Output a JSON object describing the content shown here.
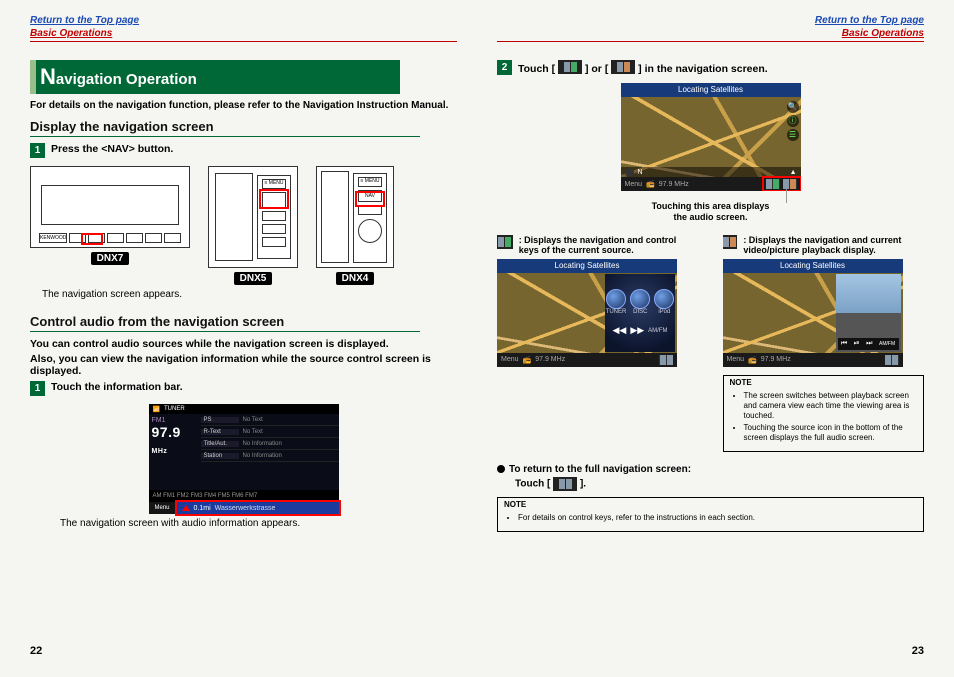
{
  "nav": {
    "return_top": "Return to the Top page",
    "basic_ops": "Basic Operations"
  },
  "section_title": {
    "big": "N",
    "rest": "avigation Operation"
  },
  "detail_note": "For details on the navigation function, please refer to the Navigation Instruction Manual.",
  "h2_display": "Display the navigation screen",
  "step1a": {
    "num": "1",
    "text": "Press the <NAV> button."
  },
  "devices": {
    "dnx7": "DNX7",
    "dnx5": "DNX5",
    "dnx4": "DNX4",
    "kenwood": "KENWOOD",
    "menu": "≡ MENU",
    "nav_label": "NAV"
  },
  "caption_nav_appears": "The navigation screen appears.",
  "h2_control": "Control audio from the navigation screen",
  "control_p1": "You can control audio sources while the navigation screen is displayed.",
  "control_p2": "Also, you can view the navigation information while the source control screen is displayed.",
  "step1b": {
    "num": "1",
    "text": "Touch the information bar."
  },
  "tuner": {
    "top": "TUNER",
    "band": "FM1",
    "freq": "97.9",
    "mhz": "MHz",
    "rows": [
      {
        "lab": "PS",
        "val": "No Text"
      },
      {
        "lab": "R-Text",
        "val": "No Text"
      },
      {
        "lab": "Title/Aut.",
        "val": "No Information"
      },
      {
        "lab": "Station",
        "val": "No Information"
      }
    ],
    "bottom_bands": "AM   FM1   FM2   FM3   FM4   FM5   FM6   FM7",
    "menu": "Menu",
    "info_dist": "0.1mi",
    "info_street": "Wasserwerkstrasse"
  },
  "caption_nav_audio": "The navigation screen with audio information appears.",
  "right": {
    "step2": {
      "num": "2",
      "text_a": "Touch [",
      "text_b": "] or [",
      "text_c": "] in the navigation screen."
    },
    "sat": "Locating Satellites",
    "map_menu": "Menu",
    "map_n": "N",
    "map_freq": "97.9 MHz",
    "touch_area_caption1": "Touching this area displays",
    "touch_area_caption2": "the audio screen.",
    "icon_def1": ": Displays the navigation and control keys of the current source.",
    "icon_def2": ": Displays the navigation and current video/picture playback display.",
    "src_labels": {
      "tuner": "TUNER",
      "disc": "DISC",
      "ipod": "iPod",
      "amfm": "AM/FM"
    },
    "play_ctrl": {
      "prev": "⏮",
      "play": "⏯",
      "next": "⏭",
      "amfm": "AM/FM"
    },
    "note1_head": "NOTE",
    "note1_items": [
      "The screen switches between playback screen and camera view each time the viewing area is touched.",
      "Touching the source icon in the bottom of the screen displays the full audio screen."
    ],
    "return_full_a": "To return to the full navigation screen:",
    "return_full_b1": "Touch [",
    "return_full_b2": "].",
    "note2_head": "NOTE",
    "note2_items": [
      "For details on control keys, refer to the instructions in each section."
    ]
  },
  "page_left": "22",
  "page_right": "23"
}
